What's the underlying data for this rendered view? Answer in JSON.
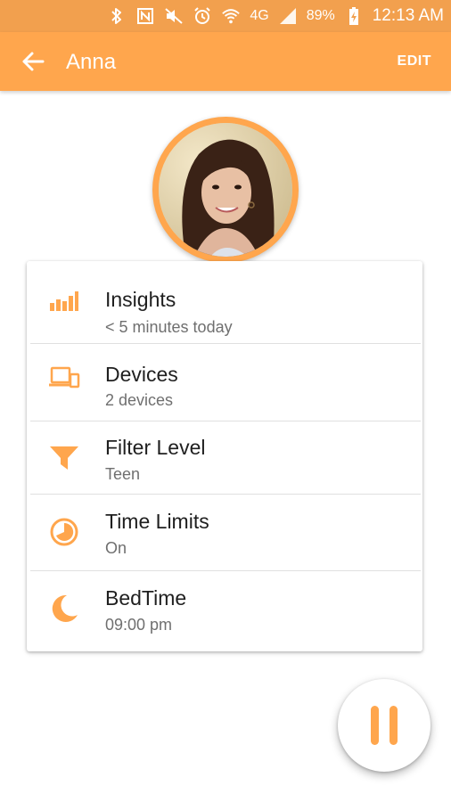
{
  "status_bar": {
    "battery": "89%",
    "time": "12:13 AM",
    "network": "4G",
    "icons": [
      "bluetooth-icon",
      "nfc-icon",
      "mute-icon",
      "alarm-icon",
      "wifi-icon",
      "signal-icon",
      "battery-charging-icon"
    ]
  },
  "app_bar": {
    "title": "Anna",
    "edit_label": "EDIT",
    "back_icon": "arrow-left-icon"
  },
  "profile": {
    "avatar": "profile-photo"
  },
  "menu": {
    "items": [
      {
        "title": "Insights",
        "subtitle": "< 5 minutes today",
        "icon": "bar-chart-icon"
      },
      {
        "title": "Devices",
        "subtitle": "2 devices",
        "icon": "devices-icon"
      },
      {
        "title": "Filter Level",
        "subtitle": "Teen",
        "icon": "filter-icon"
      },
      {
        "title": "Time Limits",
        "subtitle": "On",
        "icon": "clock-icon"
      },
      {
        "title": "BedTime",
        "subtitle": "09:00 pm",
        "icon": "moon-icon"
      }
    ]
  },
  "fab": {
    "icon": "pause-icon"
  },
  "colors": {
    "accent": "#ffa64d",
    "status_bar": "#f2a04e",
    "title_text": "#1f1f1f",
    "subtitle_text": "#6f6f6f"
  }
}
